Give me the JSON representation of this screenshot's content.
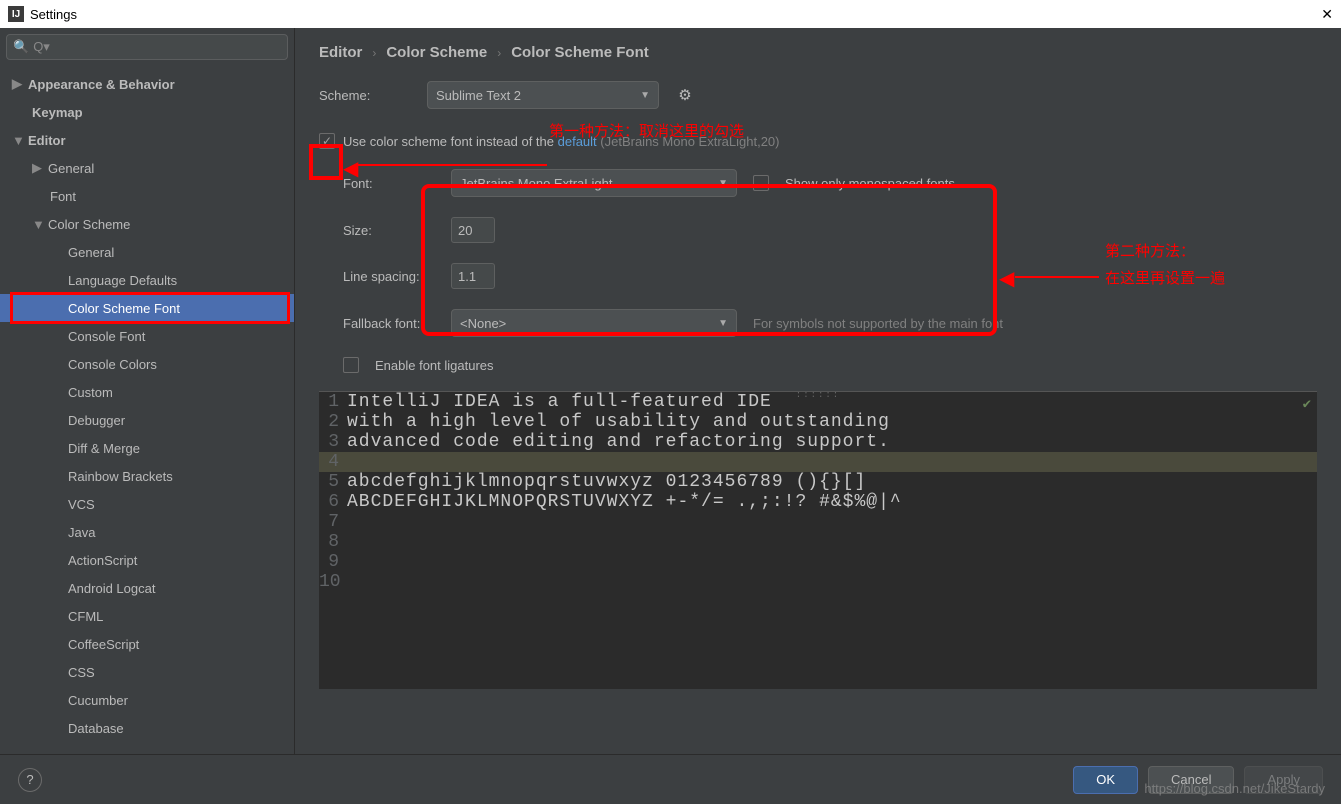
{
  "window": {
    "title": "Settings"
  },
  "search": {
    "placeholder": "Q▾"
  },
  "tree": {
    "appearance": "Appearance & Behavior",
    "keymap": "Keymap",
    "editor": "Editor",
    "general": "General",
    "font": "Font",
    "colorScheme": "Color Scheme",
    "cs_general": "General",
    "cs_langDefaults": "Language Defaults",
    "cs_font": "Color Scheme Font",
    "cs_consoleFont": "Console Font",
    "cs_consoleColors": "Console Colors",
    "cs_custom": "Custom",
    "cs_debugger": "Debugger",
    "cs_diff": "Diff & Merge",
    "cs_rainbow": "Rainbow Brackets",
    "cs_vcs": "VCS",
    "cs_java": "Java",
    "cs_actionscript": "ActionScript",
    "cs_android": "Android Logcat",
    "cs_cfml": "CFML",
    "cs_coffee": "CoffeeScript",
    "cs_css": "CSS",
    "cs_cucumber": "Cucumber",
    "cs_database": "Database"
  },
  "breadcrumb": {
    "a": "Editor",
    "b": "Color Scheme",
    "c": "Color Scheme Font"
  },
  "scheme": {
    "label": "Scheme:",
    "value": "Sublime Text 2"
  },
  "useScheme": {
    "text_pre": "Use color scheme font instead of the ",
    "link": "default",
    "hint": " (JetBrains Mono ExtraLight,20)"
  },
  "fontRow": {
    "label": "Font:",
    "value": "JetBrains Mono ExtraLight",
    "mono": "Show only monospaced fonts"
  },
  "sizeRow": {
    "label": "Size:",
    "value": "20"
  },
  "lineRow": {
    "label": "Line spacing:",
    "value": "1.1"
  },
  "fallback": {
    "label": "Fallback font:",
    "value": "<None>",
    "hint": "For symbols not supported by the main font"
  },
  "ligatures": "Enable font ligatures",
  "annotations": {
    "a1": "第一种方法：取消这里的勾选",
    "a2a": "第二种方法：",
    "a2b": "在这里再设置一遍"
  },
  "preview": {
    "l1": "IntelliJ IDEA is a full-featured IDE",
    "l2": "with a high level of usability and outstanding",
    "l3": "advanced code editing and refactoring support.",
    "l4": "",
    "l5": "abcdefghijklmnopqrstuvwxyz 0123456789 (){}[]",
    "l6": "ABCDEFGHIJKLMNOPQRSTUVWXYZ +-*/= .,;:!? #&$%@|^",
    "l7": "",
    "l8": "",
    "l9": "",
    "l10": ""
  },
  "footer": {
    "ok": "OK",
    "cancel": "Cancel",
    "apply": "Apply"
  },
  "watermark": "https://blog.csdn.net/JikeStardy"
}
